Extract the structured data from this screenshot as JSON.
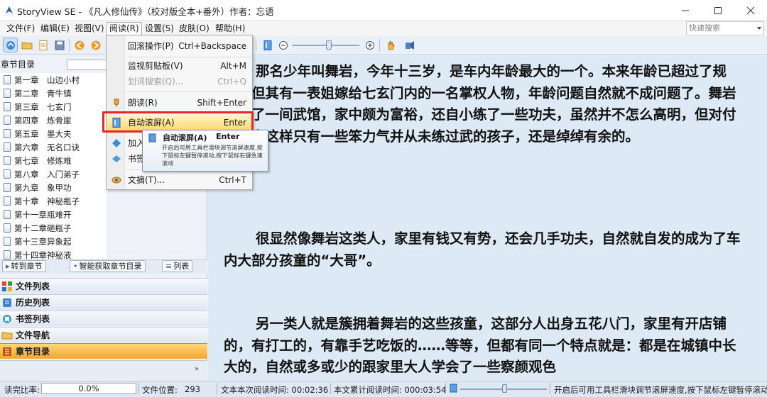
{
  "window": {
    "title": "StoryView SE - 《凡人修仙传》（校对版全本+番外）作者：忘语",
    "icons": [
      "app-icon",
      "minimize-icon",
      "maximize-icon",
      "close-icon"
    ]
  },
  "menubar": {
    "items": [
      "文件(F)",
      "编辑(E)",
      "视图(V)",
      "阅读(R)",
      "设置(S)",
      "皮肤(O)",
      "帮助(H)"
    ],
    "active_index": 3,
    "quick_search_placeholder": "快速搜索"
  },
  "read_menu": {
    "items": [
      {
        "label": "回滚操作(P)",
        "shortcut": "Ctrl+Backspace",
        "disabled": false
      },
      {
        "label": "监视剪贴板(V)",
        "shortcut": "Alt+M",
        "disabled": false
      },
      {
        "label": "划词搜索(Q)...",
        "shortcut": "Ctrl+Q",
        "disabled": true
      },
      {
        "label": "朗读(R)",
        "shortcut": "Shift+Enter",
        "disabled": false
      },
      {
        "label": "自动滚屏(A)",
        "shortcut": "Enter",
        "disabled": false
      },
      {
        "label": "加入",
        "shortcut": "",
        "disabled": false
      },
      {
        "label": "书签",
        "shortcut": "",
        "disabled": false
      },
      {
        "label": "文摘(T)...",
        "shortcut": "Ctrl+T",
        "disabled": false
      }
    ],
    "highlight_index": 4,
    "highlight_color": "#e8262a"
  },
  "tooltip": {
    "title": "自动滚屏(A)",
    "shortcut": "Enter",
    "description": "开启后可用工具栏滑块调节滚屏速度,按下鼠标左键暂停滚动,按下鼠标右键急速滚动"
  },
  "sidebar": {
    "header": "章节目录",
    "chapters": [
      {
        "num": "第一章",
        "title": "山边小村"
      },
      {
        "num": "第二章",
        "title": "青牛镇"
      },
      {
        "num": "第三章",
        "title": "七玄门"
      },
      {
        "num": "第四章",
        "title": "炼骨崖"
      },
      {
        "num": "第五章",
        "title": "墨大夫"
      },
      {
        "num": "第六章",
        "title": "无名口诀"
      },
      {
        "num": "第七章",
        "title": "修炼难"
      },
      {
        "num": "第八章",
        "title": "入门弟子"
      },
      {
        "num": "第九章",
        "title": "象甲功"
      },
      {
        "num": "第十章",
        "title": "神秘瓶子"
      },
      {
        "num": "第十一章",
        "title": "瓶难开"
      },
      {
        "num": "第十二章",
        "title": "砸瓶子"
      },
      {
        "num": "第十三章",
        "title": "异象起"
      },
      {
        "num": "第十四章",
        "title": "神秘液"
      }
    ],
    "buttons": {
      "goto": "转到章节",
      "smart": "智能获取章节目录",
      "list": "列表"
    },
    "sections": [
      "文件列表",
      "历史列表",
      "书签列表",
      "文件导航",
      "章节目录"
    ],
    "selected_section_index": 4,
    "selected_color": "#f4a62c"
  },
  "reader": {
    "paragraphs": [
      "那名少年叫舞岩，今年十三岁，是车内年龄最大的一个。本来年龄已超过了规定，但其有一表姐嫁给七玄门内的一名掌权人物，年龄问题自然就不成问题了。舞岩家开了一间武馆，家中颇为富裕，还自小练了一些功夫，虽然并不怎么高明，但对付像韩立这样只有一些笨力气并从未练过武的孩子，还是绰绰有余的。",
      "很显然像舞岩这类人，家里有钱又有势，还会几手功夫，自然就自发的成为了车内大部分孩童的“大哥”。",
      "另一类人就是簇拥着舞岩的这些孩童，这部分人出身五花八门，家里有开店铺的，有打工的，有靠手艺吃饭的……等等，但都有同一个特点就是：都是在城镇中长大的，自然或多或少的跟家里大人学会了一些察颜观色"
    ],
    "background": "#dde9f5"
  },
  "statusbar": {
    "read_ratio_label": "读完比率:",
    "read_ratio_value": "0.0%",
    "file_pos_label": "文件位置:",
    "file_pos_value": "293",
    "session_time": "文本本次阅读时间: 00:02:36",
    "total_time": "本文累计阅读时间: 000:03:54",
    "hint": "开启后可用工具栏滑块调节滚屏速度,按下鼠标左键暂停滚动"
  }
}
